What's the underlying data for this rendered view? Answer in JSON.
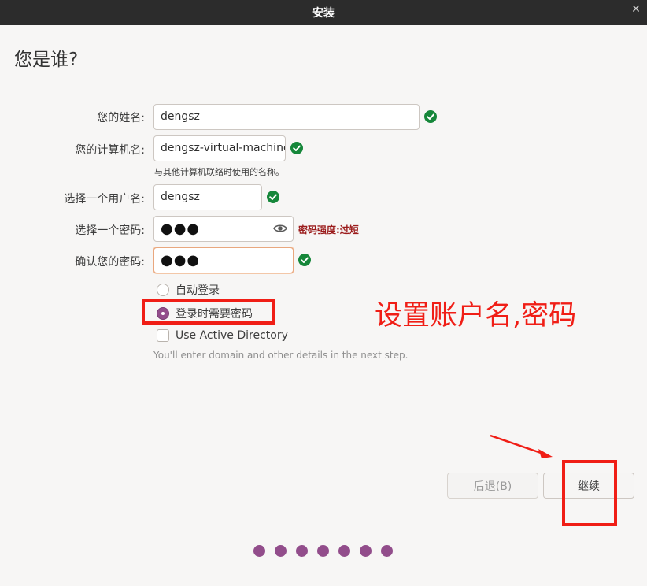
{
  "window": {
    "title": "安装"
  },
  "page": {
    "title": "您是谁?"
  },
  "form": {
    "name": {
      "label": "您的姓名:",
      "value": "dengsz"
    },
    "computer": {
      "label": "您的计算机名:",
      "value": "dengsz-virtual-machine",
      "hint": "与其他计算机联络时使用的名称。"
    },
    "username": {
      "label": "选择一个用户名:",
      "value": "dengsz"
    },
    "password": {
      "label": "选择一个密码:",
      "value": "●●●",
      "strength": "密码强度:过短"
    },
    "confirm": {
      "label": "确认您的密码:",
      "value": "●●●"
    }
  },
  "options": {
    "auto_login": "自动登录",
    "require_password": "登录时需要密码",
    "active_directory": "Use Active Directory",
    "ad_hint": "You'll enter domain and other details in the next step."
  },
  "buttons": {
    "back": "后退(B)",
    "continue": "继续"
  },
  "annotation": {
    "text": "设置账户名,密码"
  },
  "progress": {
    "steps": 7
  },
  "colors": {
    "accent": "#924d8b",
    "annotation": "#f01e16",
    "check": "#16873a",
    "strength": "#9b1c1c"
  }
}
